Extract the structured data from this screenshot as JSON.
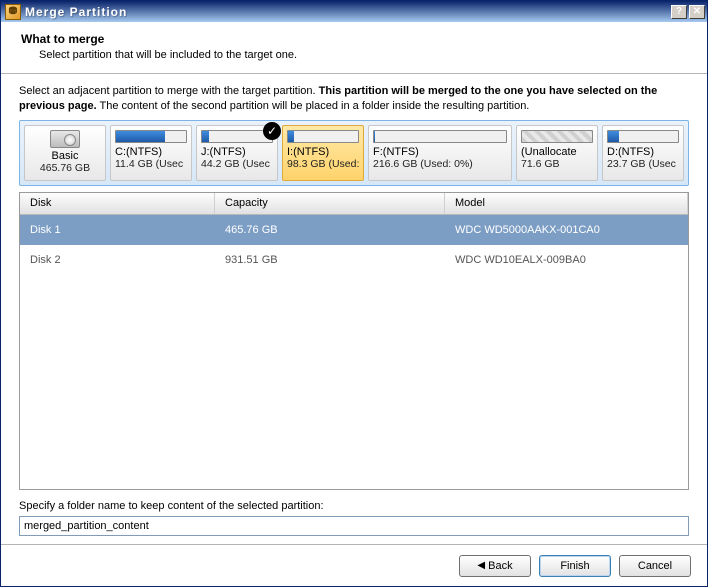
{
  "window": {
    "title": "Merge Partition",
    "help_btn": "?",
    "close_btn": "✕"
  },
  "header": {
    "title": "What to merge",
    "subtitle": "Select partition that will be included to the target one."
  },
  "intro": {
    "lead": "Select an adjacent partition to merge with the target partition. ",
    "bold": "This partition will be merged to the one you have selected on the previous page.",
    "tail": " The content of the second partition will be placed in a folder inside the resulting partition."
  },
  "partitions": [
    {
      "kind": "disk",
      "label": "Basic",
      "sub": "465.76 GB"
    },
    {
      "kind": "part",
      "label": "C:(NTFS)",
      "sub": "11.4 GB (Usec",
      "fill_pct": 70
    },
    {
      "kind": "part",
      "label": "J:(NTFS)",
      "sub": "44.2 GB (Usec",
      "fill_pct": 10,
      "badge": true
    },
    {
      "kind": "part",
      "label": "I:(NTFS)",
      "sub": "98.3 GB (Used:",
      "fill_pct": 8,
      "selected": true
    },
    {
      "kind": "part",
      "label": "F:(NTFS)",
      "sub": "216.6 GB (Used: 0%)",
      "fill_pct": 1,
      "wide": true
    },
    {
      "kind": "unalloc",
      "label": "(Unallocate",
      "sub": "71.6 GB"
    },
    {
      "kind": "part",
      "label": "D:(NTFS)",
      "sub": "23.7 GB (Usec",
      "fill_pct": 15
    }
  ],
  "disk_table": {
    "columns": {
      "disk": "Disk",
      "capacity": "Capacity",
      "model": "Model"
    },
    "rows": [
      {
        "disk": "Disk 1",
        "capacity": "465.76 GB",
        "model": "WDC WD5000AAKX-001CA0",
        "selected": true
      },
      {
        "disk": "Disk 2",
        "capacity": "931.51 GB",
        "model": "WDC WD10EALX-009BA0",
        "selected": false
      }
    ]
  },
  "folder": {
    "label": "Specify a folder name to keep content of the selected partition:",
    "value": "merged_partition_content"
  },
  "footer": {
    "back": "Back",
    "finish": "Finish",
    "cancel": "Cancel"
  }
}
